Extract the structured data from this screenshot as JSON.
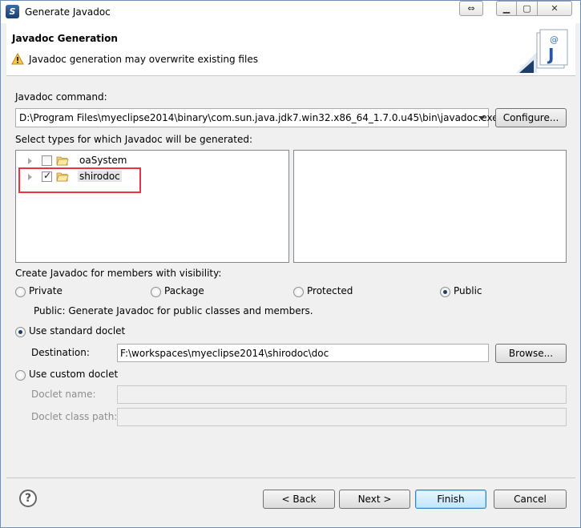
{
  "window": {
    "title": "Generate Javadoc"
  },
  "banner": {
    "title": "Javadoc Generation",
    "message": "Javadoc generation may overwrite existing files"
  },
  "command": {
    "label": "Javadoc command:",
    "value": "D:\\Program Files\\myeclipse2014\\binary\\com.sun.java.jdk7.win32.x86_64_1.7.0.u45\\bin\\javadoc.exe",
    "configure_label": "Configure..."
  },
  "types": {
    "label": "Select types for which Javadoc will be generated:",
    "items": [
      {
        "label": "oaSystem",
        "checked": false
      },
      {
        "label": "shirodoc",
        "checked": true
      }
    ]
  },
  "visibility": {
    "label": "Create Javadoc for members with visibility:",
    "options": [
      "Private",
      "Package",
      "Protected",
      "Public"
    ],
    "selected": "Public",
    "description": "Public: Generate Javadoc for public classes and members."
  },
  "standard_doclet": {
    "label": "Use standard doclet",
    "destination_label": "Destination:",
    "destination_value": "F:\\workspaces\\myeclipse2014\\shirodoc\\doc",
    "browse_label": "Browse..."
  },
  "custom_doclet": {
    "label": "Use custom doclet",
    "name_label": "Doclet name:",
    "classpath_label": "Doclet class path:"
  },
  "footer": {
    "back_label": "< Back",
    "next_label": "Next >",
    "finish_label": "Finish",
    "cancel_label": "Cancel"
  },
  "colors": {
    "highlight_box": "#e8343b",
    "default_button": "#3c7fb1"
  }
}
